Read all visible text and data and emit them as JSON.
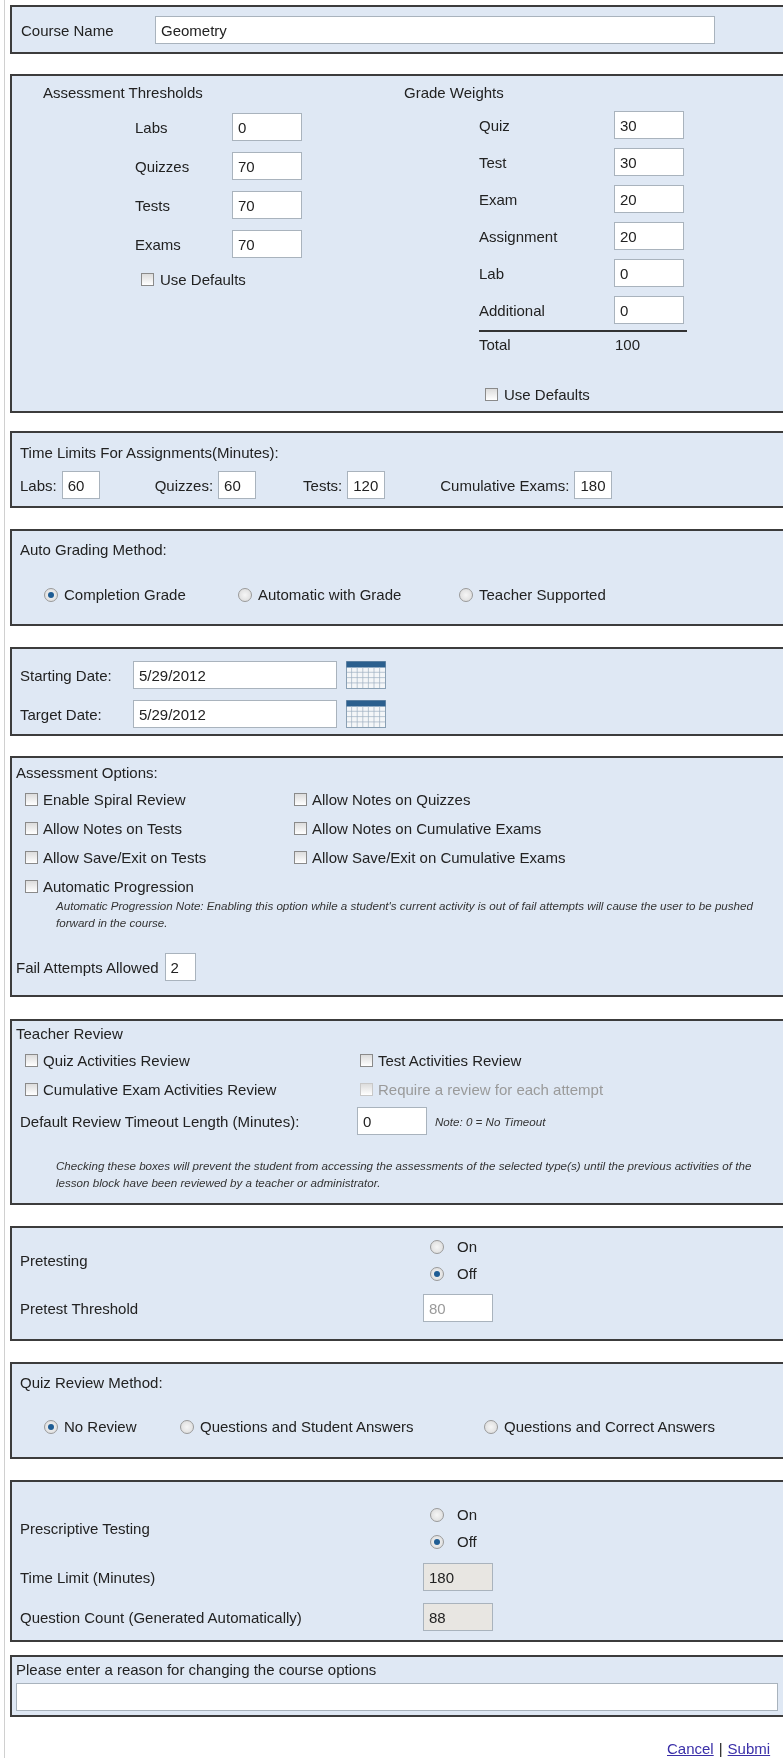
{
  "course_name": {
    "label": "Course Name",
    "value": "Geometry"
  },
  "thresholds": {
    "title": "Assessment Thresholds",
    "fields": [
      {
        "label": "Labs",
        "value": "0"
      },
      {
        "label": "Quizzes",
        "value": "70"
      },
      {
        "label": "Tests",
        "value": "70"
      },
      {
        "label": "Exams",
        "value": "70"
      }
    ],
    "use_defaults": {
      "label": "Use Defaults",
      "checked": false
    }
  },
  "grade_weights": {
    "title": "Grade Weights",
    "fields": [
      {
        "label": "Quiz",
        "value": "30"
      },
      {
        "label": "Test",
        "value": "30"
      },
      {
        "label": "Exam",
        "value": "20"
      },
      {
        "label": "Assignment",
        "value": "20"
      },
      {
        "label": "Lab",
        "value": "0"
      },
      {
        "label": "Additional",
        "value": "0"
      }
    ],
    "total": {
      "label": "Total",
      "value": "100"
    },
    "use_defaults": {
      "label": "Use Defaults",
      "checked": false
    }
  },
  "time_limits": {
    "title": "Time Limits For Assignments(Minutes):",
    "fields": [
      {
        "label": "Labs:",
        "value": "60"
      },
      {
        "label": "Quizzes:",
        "value": "60"
      },
      {
        "label": "Tests:",
        "value": "120"
      },
      {
        "label": "Cumulative Exams:",
        "value": "180"
      }
    ]
  },
  "auto_grading": {
    "title": "Auto Grading Method:",
    "options": [
      {
        "label": "Completion Grade",
        "selected": true
      },
      {
        "label": "Automatic with Grade",
        "selected": false
      },
      {
        "label": "Teacher Supported",
        "selected": false
      }
    ]
  },
  "dates": [
    {
      "label": "Starting Date:",
      "value": "5/29/2012"
    },
    {
      "label": "Target Date:",
      "value": "5/29/2012"
    }
  ],
  "assessment_options": {
    "title": "Assessment Options:",
    "options": [
      {
        "label": "Enable Spiral Review",
        "checked": false
      },
      {
        "label": "Allow Notes on Quizzes",
        "checked": false
      },
      {
        "label": "Allow Notes on Tests",
        "checked": false
      },
      {
        "label": "Allow Notes on Cumulative Exams",
        "checked": false
      },
      {
        "label": "Allow Save/Exit on Tests",
        "checked": false
      },
      {
        "label": "Allow Save/Exit on Cumulative Exams",
        "checked": false
      },
      {
        "label": "Automatic Progression",
        "checked": false
      }
    ],
    "note": "Automatic Progression Note: Enabling this option while a student's current activity is out of fail attempts will cause the user to be pushed forward in the course.",
    "fail_attempts": {
      "label": "Fail Attempts Allowed",
      "value": "2"
    }
  },
  "teacher_review": {
    "title": "Teacher Review",
    "options": [
      {
        "label": "Quiz Activities Review",
        "checked": false,
        "disabled": false
      },
      {
        "label": "Test Activities Review",
        "checked": false,
        "disabled": false
      },
      {
        "label": "Cumulative Exam Activities Review",
        "checked": false,
        "disabled": false
      },
      {
        "label": "Require a review for each attempt",
        "checked": false,
        "disabled": true
      }
    ],
    "timeout": {
      "label": "Default Review Timeout Length (Minutes):",
      "value": "0",
      "note": "Note: 0 = No Timeout"
    },
    "note": "Checking these boxes will prevent the student from accessing the assessments of the selected type(s) until the previous activities of the lesson block have been reviewed by a teacher or administrator."
  },
  "pretesting": {
    "label": "Pretesting",
    "options": [
      {
        "label": "On",
        "selected": false
      },
      {
        "label": "Off",
        "selected": true
      }
    ],
    "threshold": {
      "label": "Pretest Threshold",
      "value": "80",
      "disabled": true
    }
  },
  "quiz_review": {
    "title": "Quiz Review Method:",
    "options": [
      {
        "label": "No Review",
        "selected": true
      },
      {
        "label": "Questions and Student Answers",
        "selected": false
      },
      {
        "label": "Questions and Correct Answers",
        "selected": false
      }
    ]
  },
  "prescriptive": {
    "label": "Prescriptive Testing",
    "options": [
      {
        "label": "On",
        "selected": false
      },
      {
        "label": "Off",
        "selected": true
      }
    ],
    "fields": [
      {
        "label": "Time Limit (Minutes)",
        "value": "180",
        "readonly": true
      },
      {
        "label": "Question Count (Generated Automatically)",
        "value": "88",
        "readonly": true
      }
    ]
  },
  "reason": {
    "label": "Please enter a reason for changing the course options"
  },
  "links": {
    "items": [
      {
        "label": "Cancel"
      },
      {
        "label": "Submi"
      }
    ],
    "separator": "|"
  }
}
